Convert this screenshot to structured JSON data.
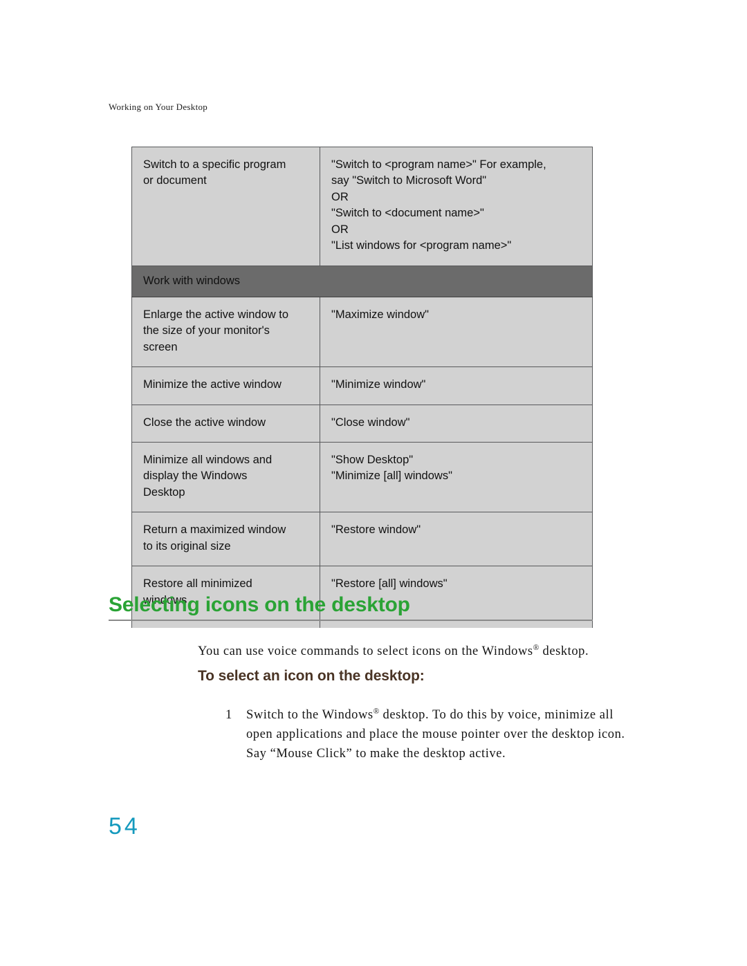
{
  "header": {
    "running_head": "Working on Your Desktop"
  },
  "table": {
    "rows": [
      {
        "type": "data",
        "action": [
          "Switch to a specific program",
          "or document"
        ],
        "command": [
          "\"Switch to <program name>\" For example,",
          "say \"Switch to Microsoft Word\"",
          "OR",
          "\"Switch to <document name>\"",
          "OR",
          " \"List windows for <program name>\""
        ]
      },
      {
        "type": "section",
        "label": "Work with windows"
      },
      {
        "type": "data",
        "action": [
          "Enlarge the active window to",
          "the size of your monitor's",
          "screen"
        ],
        "command": [
          "\"Maximize window\""
        ]
      },
      {
        "type": "data",
        "action": [
          "Minimize the active window"
        ],
        "command": [
          "\"Minimize window\""
        ]
      },
      {
        "type": "data",
        "action": [
          "Close the active window"
        ],
        "command": [
          "\"Close window\""
        ]
      },
      {
        "type": "data",
        "action": [
          "Minimize all windows and",
          "display the Windows",
          "Desktop"
        ],
        "command": [
          "\"Show Desktop\"",
          "\"Minimize [all] windows\""
        ]
      },
      {
        "type": "data",
        "action": [
          "Return a maximized window",
          "to its original size"
        ],
        "command": [
          "\"Restore window\""
        ]
      },
      {
        "type": "data",
        "clipped": true,
        "action": [
          "Restore all minimized",
          "windows"
        ],
        "command": [
          "\"Restore [all] windows\""
        ]
      }
    ]
  },
  "section": {
    "heading": "Selecting icons on the desktop",
    "intro_before_mark": "You can use voice commands to select icons on the Windows",
    "intro_mark": "®",
    "intro_after_mark": " desktop.",
    "subheading": "To select an icon on the desktop:",
    "steps": [
      {
        "number": "1",
        "text_before_mark": "Switch to the Windows",
        "mark": "®",
        "text_after_mark": " desktop. To do this by voice, minimize all open applications and place the mouse pointer over the desktop icon. Say “Mouse Click” to make the desktop active."
      }
    ]
  },
  "footer": {
    "page_number": "54"
  },
  "colors": {
    "heading_green": "#2aa335",
    "subheading_brown": "#4a3425",
    "folio_teal": "#1499bd",
    "table_cell_bg": "#d2d2d2",
    "table_section_bg": "#6b6b6b",
    "table_border": "#58595b",
    "rule_gray": "#8a8a8a"
  }
}
